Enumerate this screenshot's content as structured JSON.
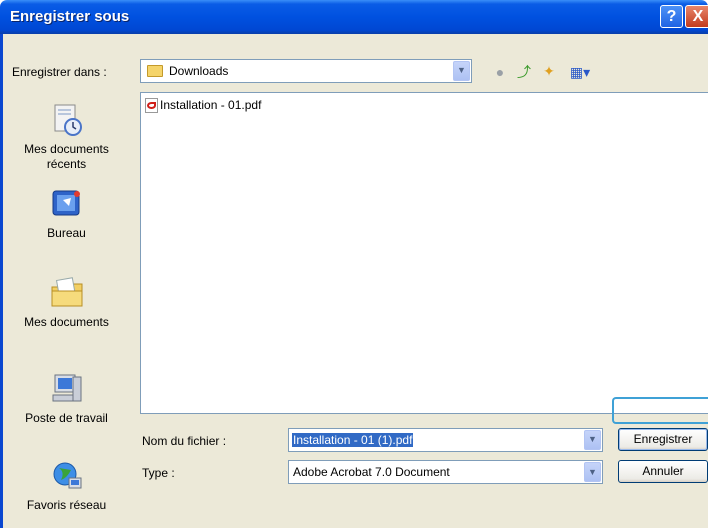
{
  "window": {
    "title": "Enregistrer sous",
    "help_glyph": "?",
    "close_glyph": "X"
  },
  "save_in": {
    "label": "Enregistrer dans :",
    "value": "Downloads"
  },
  "toolbar": {
    "icons": [
      "back-icon",
      "up-folder-icon",
      "new-folder-icon",
      "view-menu-icon"
    ]
  },
  "places": [
    {
      "label": "Mes documents récents",
      "icon": "recent-documents-icon"
    },
    {
      "label": "Bureau",
      "icon": "desktop-icon"
    },
    {
      "label": "Mes documents",
      "icon": "my-documents-icon"
    },
    {
      "label": "Poste de travail",
      "icon": "my-computer-icon"
    },
    {
      "label": "Favoris réseau",
      "icon": "network-places-icon"
    }
  ],
  "files": [
    {
      "name": "Installation - 01.pdf",
      "icon": "pdf-icon"
    }
  ],
  "filename": {
    "label": "Nom du fichier :",
    "value": "Installation - 01 (1).pdf"
  },
  "filetype": {
    "label": "Type :",
    "value": "Adobe Acrobat 7.0 Document"
  },
  "buttons": {
    "save": "Enregistrer",
    "cancel": "Annuler"
  },
  "colors": {
    "titlebar": "#0051e0",
    "dialog_bg": "#ece9d8",
    "selection": "#316ac5",
    "focus_ring": "#3fa1d6"
  }
}
